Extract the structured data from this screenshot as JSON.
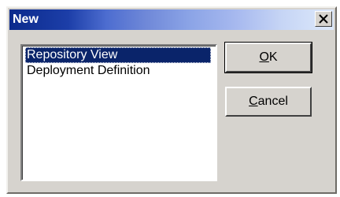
{
  "dialog": {
    "title": "New",
    "close_glyph": "✕"
  },
  "list": {
    "items": [
      {
        "label": "Repository View",
        "selected": true
      },
      {
        "label": "Deployment Definition",
        "selected": false
      }
    ]
  },
  "buttons": {
    "ok_label": "OK",
    "cancel_label": "Cancel"
  },
  "colors": {
    "selection": "#0a246a",
    "dialog_face": "#d6d3ce"
  }
}
